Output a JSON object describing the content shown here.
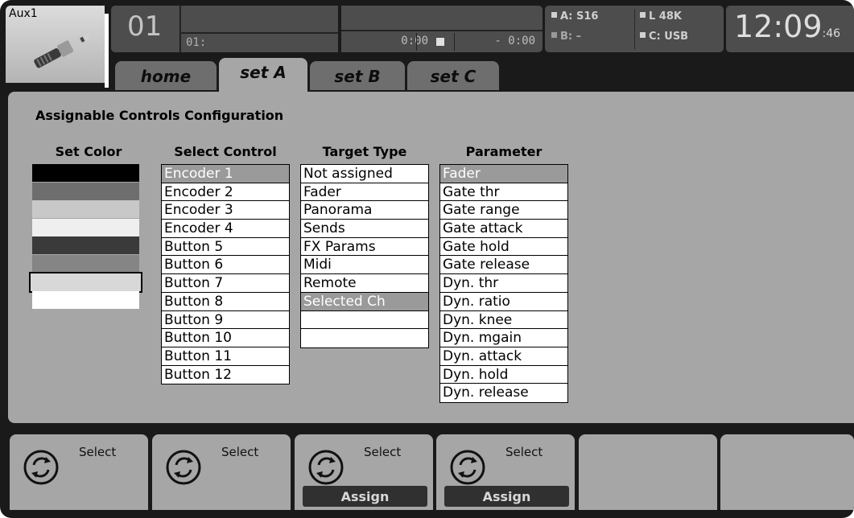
{
  "header": {
    "channel_name": "Aux1",
    "channel_icon": "jack-plug-icon",
    "channel_number": "01",
    "track_label": "01:",
    "elapsed_time": "0:00",
    "remaining_time": "- 0:00",
    "stop_icon": "stop-icon",
    "status": {
      "a": "A: S16",
      "b": "B:  –",
      "l": "L  48K",
      "c": "C: USB"
    },
    "clock": "12:09",
    "clock_seconds": ":46"
  },
  "tabs": [
    {
      "label": "home"
    },
    {
      "label": "set A"
    },
    {
      "label": "set B"
    },
    {
      "label": "set C"
    }
  ],
  "active_tab": "set A",
  "main": {
    "title": "Assignable Controls Configuration",
    "set_color": {
      "heading": "Set Color",
      "colors": [
        "#000000",
        "#6e6e6e",
        "#c8c8c8",
        "#efefef",
        "#3a3a3a",
        "#858585",
        "#d8d8d8",
        "#ffffff"
      ],
      "selected_index": 6
    },
    "select_control": {
      "heading": "Select Control",
      "items": [
        "Encoder 1",
        "Encoder 2",
        "Encoder 3",
        "Encoder 4",
        "Button 5",
        "Button 6",
        "Button 7",
        "Button 8",
        "Button 9",
        "Button 10",
        "Button 11",
        "Button 12"
      ],
      "selected": "Encoder 1"
    },
    "target_type": {
      "heading": "Target Type",
      "items": [
        "Not assigned",
        "Fader",
        "Panorama",
        "Sends",
        "FX Params",
        "Midi",
        "Remote",
        "Selected Ch",
        "",
        ""
      ],
      "selected": "Selected Ch"
    },
    "parameter": {
      "heading": "Parameter",
      "items": [
        "Fader",
        "Gate thr",
        "Gate range",
        "Gate attack",
        "Gate hold",
        "Gate release",
        "Dyn. thr",
        "Dyn. ratio",
        "Dyn. knee",
        "Dyn. mgain",
        "Dyn. attack",
        "Dyn. hold",
        "Dyn. release"
      ],
      "selected": "Fader"
    }
  },
  "softkeys": [
    {
      "label": "Select",
      "icon": "rotary-encoder-icon",
      "assign": ""
    },
    {
      "label": "Select",
      "icon": "rotary-encoder-icon",
      "assign": ""
    },
    {
      "label": "Select",
      "icon": "rotary-encoder-icon",
      "assign": "Assign"
    },
    {
      "label": "Select",
      "icon": "rotary-encoder-icon",
      "assign": "Assign"
    },
    {
      "label": "",
      "icon": "",
      "assign": ""
    },
    {
      "label": "",
      "icon": "",
      "assign": ""
    }
  ]
}
